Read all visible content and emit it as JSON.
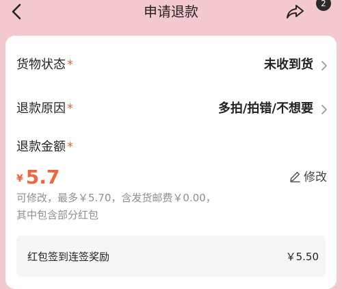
{
  "header": {
    "title": "申请退款",
    "badge_count": "2",
    "icons": {
      "back": "chevron-left-icon",
      "share": "share-arrow-icon"
    }
  },
  "form": {
    "goods_status": {
      "label": "货物状态",
      "required_mark": "*",
      "value": "未收到货"
    },
    "refund_reason": {
      "label": "退款原因",
      "required_mark": "*",
      "value": "多拍/拍错/不想要"
    },
    "refund_amount": {
      "label": "退款金额",
      "required_mark": "*",
      "currency": "¥",
      "value": "5.7",
      "edit_label": "修改",
      "hint_line1": "可修改，最多￥5.70，含发货邮费￥0.00，",
      "hint_line2": "其中包含部分红包"
    },
    "breakdown": {
      "label": "红包签到连签奖励",
      "value": "￥5.50"
    }
  },
  "colors": {
    "header_bg": "#f3c8cf",
    "accent": "#f0653a",
    "hint_text": "#8f8f8f",
    "panel_bg": "#f6f6f6"
  }
}
